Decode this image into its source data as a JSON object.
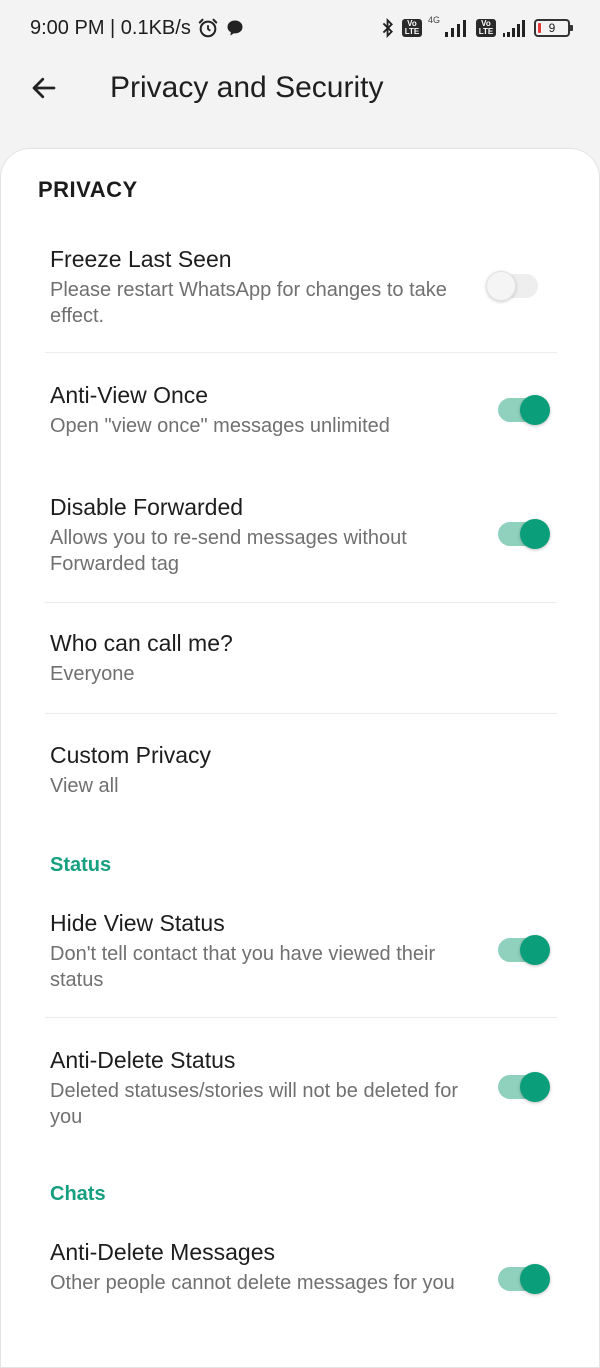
{
  "status_bar": {
    "time_speed": "9:00 PM | 0.1KB/s",
    "net_type": "4G",
    "volte": "Vo LTE",
    "battery": "9",
    "icons": [
      "alarm-icon",
      "chat-bubble-icon",
      "bluetooth-icon",
      "volte-icon",
      "signal-icon",
      "battery-icon"
    ]
  },
  "header": {
    "title": "Privacy and Security"
  },
  "sections": {
    "privacy": "PRIVACY",
    "status": "Status",
    "chats": "Chats"
  },
  "items": {
    "freeze_last_seen": {
      "title": "Freeze Last Seen",
      "summary": "Please restart WhatsApp for changes to take effect.",
      "enabled": false
    },
    "anti_view_once": {
      "title": "Anti-View Once",
      "summary": "Open \"view once\" messages unlimited",
      "enabled": true
    },
    "disable_forwarded": {
      "title": "Disable Forwarded",
      "summary": "Allows you to re-send messages without Forwarded tag",
      "enabled": true
    },
    "who_can_call": {
      "title": "Who can call me?",
      "summary": "Everyone"
    },
    "custom_privacy": {
      "title": "Custom Privacy",
      "summary": "View all"
    },
    "hide_view_status": {
      "title": "Hide View Status",
      "summary": "Don't tell contact that you have viewed their status",
      "enabled": true
    },
    "anti_delete_status": {
      "title": "Anti-Delete Status",
      "summary": "Deleted statuses/stories will not be deleted for you",
      "enabled": true
    },
    "anti_delete_messages": {
      "title": "Anti-Delete Messages",
      "summary": "Other people cannot delete messages for you",
      "enabled": true
    }
  },
  "colors": {
    "accent": "#17a07f",
    "switch_thumb_on": "#0a9e7a",
    "switch_track_on": "#8fd1bd"
  }
}
